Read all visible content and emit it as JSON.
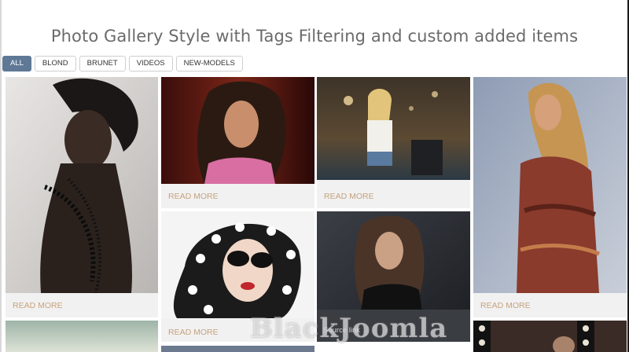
{
  "page": {
    "title": "Photo Gallery Style with Tags Filtering and custom added items"
  },
  "filters": [
    {
      "label": "ALL",
      "active": true
    },
    {
      "label": "BLOND",
      "active": false
    },
    {
      "label": "BRUNET",
      "active": false
    },
    {
      "label": "VIDEOS",
      "active": false
    },
    {
      "label": "NEW-MODELS",
      "active": false
    }
  ],
  "gallery": {
    "read_more_label": "READ MORE",
    "source_link_label": "Source link",
    "items": [
      {
        "caption": "READ MORE"
      },
      {
        "caption": "READ MORE"
      },
      {
        "caption": "READ MORE"
      },
      {
        "caption": "READ MORE"
      },
      {
        "caption": "READ MORE"
      },
      {
        "caption": "Source link"
      }
    ]
  },
  "watermark": {
    "text": "BlackJoomla"
  },
  "colors": {
    "accent": "#5f7896",
    "read_more": "#c7a27e",
    "card_bg": "#f1f1f1",
    "title": "#6b6b6b"
  }
}
